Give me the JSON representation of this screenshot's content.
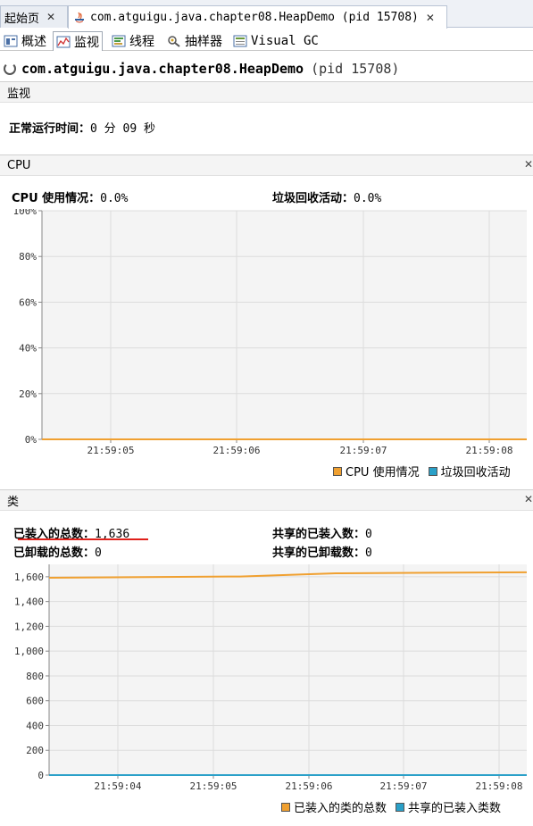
{
  "doc_tabs": [
    {
      "label": "起始页",
      "active": false
    },
    {
      "label": "com.atguigu.java.chapter08.HeapDemo (pid 15708)",
      "active": true
    }
  ],
  "sub_tabs": [
    {
      "label": "概述",
      "icon": "overview-icon"
    },
    {
      "label": "监视",
      "icon": "monitor-icon",
      "active": true
    },
    {
      "label": "线程",
      "icon": "threads-icon"
    },
    {
      "label": "抽样器",
      "icon": "sampler-icon"
    },
    {
      "label": "Visual GC",
      "icon": "visualgc-icon"
    }
  ],
  "app": {
    "name": "com.atguigu.java.chapter08.HeapDemo",
    "pid": "(pid 15708)"
  },
  "monitor": {
    "header": "监视",
    "uptime_label": "正常运行时间：",
    "uptime_value": "0 分 09 秒"
  },
  "cpu": {
    "header": "CPU",
    "usage_label": "CPU 使用情况：",
    "usage_value": "0.0%",
    "gc_label": "垃圾回收活动：",
    "gc_value": "0.0%",
    "legend_cpu": "CPU 使用情况",
    "legend_gc": "垃圾回收活动",
    "color_cpu": "#f0a030",
    "color_gc": "#2aa0c8"
  },
  "classes": {
    "header": "类",
    "loaded_label": "已装入的总数：",
    "loaded_value": "1,636",
    "unloaded_label": "已卸载的总数：",
    "unloaded_value": "0",
    "shared_loaded_label": "共享的已装入数：",
    "shared_loaded_value": "0",
    "shared_unloaded_label": "共享的已卸载数：",
    "shared_unloaded_value": "0",
    "legend_loaded": "已装入的类的总数",
    "legend_shared": "共享的已装入类数",
    "color_loaded": "#f0a030",
    "color_shared": "#2aa0c8"
  },
  "chart_data": [
    {
      "type": "line",
      "title": "CPU",
      "ylim": [
        0,
        100
      ],
      "y_ticks": [
        "0%",
        "20%",
        "40%",
        "60%",
        "80%",
        "100%"
      ],
      "x_ticks": [
        "21:59:05",
        "21:59:06",
        "21:59:07",
        "21:59:08"
      ],
      "grid": true,
      "legend": "bottom-right",
      "series": [
        {
          "name": "CPU 使用情况",
          "values": [
            0,
            0,
            0,
            0
          ]
        },
        {
          "name": "垃圾回收活动",
          "values": [
            0,
            0,
            0,
            0
          ]
        }
      ]
    },
    {
      "type": "line",
      "title": "类",
      "ylim": [
        0,
        1700
      ],
      "y_ticks": [
        "0",
        "200",
        "400",
        "600",
        "800",
        "1,000",
        "1,200",
        "1,400",
        "1,600"
      ],
      "x_ticks": [
        "21:59:04",
        "21:59:05",
        "21:59:06",
        "21:59:07",
        "21:59:08"
      ],
      "grid": true,
      "legend": "bottom-right",
      "series": [
        {
          "name": "已装入的类的总数",
          "values": [
            1592,
            1598,
            1602,
            1628,
            1632,
            1636
          ]
        },
        {
          "name": "共享的已装入类数",
          "values": [
            0,
            0,
            0,
            0,
            0,
            0
          ]
        }
      ]
    }
  ]
}
